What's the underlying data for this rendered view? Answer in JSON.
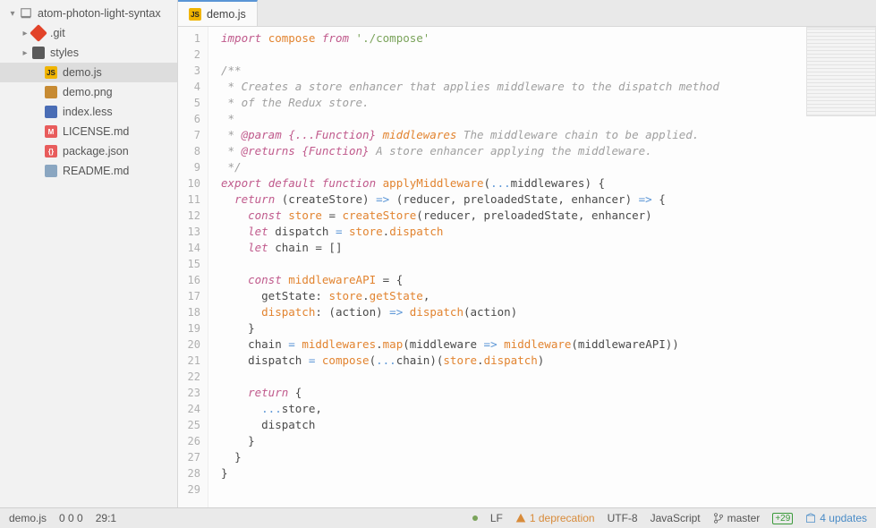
{
  "sidebar": {
    "root": "atom-photon-light-syntax",
    "items": [
      {
        "label": ".git",
        "icon": "git",
        "indent": 1,
        "chev": true
      },
      {
        "label": "styles",
        "icon": "folder",
        "indent": 1,
        "chev": true
      },
      {
        "label": "demo.js",
        "icon": "js",
        "indent": 2,
        "active": true
      },
      {
        "label": "demo.png",
        "icon": "png",
        "indent": 2
      },
      {
        "label": "index.less",
        "icon": "less",
        "indent": 2
      },
      {
        "label": "LICENSE.md",
        "icon": "md",
        "indent": 2
      },
      {
        "label": "package.json",
        "icon": "json",
        "indent": 2
      },
      {
        "label": "README.md",
        "icon": "readme",
        "indent": 2
      }
    ]
  },
  "tab": {
    "label": "demo.js"
  },
  "code_lines": 29,
  "status": {
    "file": "demo.js",
    "counts": "0   0   0",
    "cursor": "29:1",
    "eol": "LF",
    "deprecations": "1 deprecation",
    "encoding": "UTF-8",
    "language": "JavaScript",
    "branch": "master",
    "git_add": "+29",
    "updates": "4 updates"
  },
  "code": {
    "l1_import": "import",
    "l1_compose": "compose",
    "l1_from": "from",
    "l1_str": "'./compose'",
    "l3": "/**",
    "l4": " * Creates a store enhancer that applies middleware to the dispatch method",
    "l5": " * of the Redux store.",
    "l6": " *",
    "l7_a": " * ",
    "l7_tag": "@param",
    "l7_type": " {...Function}",
    "l7_name": " middlewares",
    "l7_rest": " The middleware chain to be applied.",
    "l8_a": " * ",
    "l8_tag": "@returns",
    "l8_type": " {Function}",
    "l8_rest": " A store enhancer applying the middleware.",
    "l9": " */",
    "l10_export": "export",
    "l10_default": "default",
    "l10_function": "function",
    "l10_name": "applyMiddleware",
    "l10_spread": "...",
    "l10_rest": "middlewares) {",
    "l11_return": "return",
    "l11_a": " (createStore) ",
    "l11_arrow": "=>",
    "l11_b": " (reducer, preloadedState, enhancer) ",
    "l11_arrow2": "=>",
    "l11_c": " {",
    "l12_const": "const",
    "l12_store": "store",
    "l12_eq": " = ",
    "l12_fn": "createStore",
    "l12_args": "(reducer, preloadedState, enhancer)",
    "l13_let": "let",
    "l13_a": " dispatch ",
    "l13_eq": "=",
    "l13_b": " ",
    "l13_store": "store",
    "l13_dot": ".",
    "l13_disp": "dispatch",
    "l14_let": "let",
    "l14_rest": " chain = []",
    "l16_const": "const",
    "l16_name": "middlewareAPI",
    "l16_rest": " = {",
    "l17_a": "getState",
    "l17_col": ": ",
    "l17_store": "store",
    "l17_dot": ".",
    "l17_gs": "getState",
    "l17_comma": ",",
    "l18_disp": "dispatch",
    "l18_col": ":",
    "l18_a": " (action) ",
    "l18_arrow": "=>",
    "l18_b": " ",
    "l18_fn": "dispatch",
    "l18_args": "(action)",
    "l19": "}",
    "l20_a": "chain ",
    "l20_eq": "=",
    "l20_b": " ",
    "l20_mw": "middlewares",
    "l20_dot": ".",
    "l20_map": "map",
    "l20_c": "(middleware ",
    "l20_arrow": "=>",
    "l20_d": " ",
    "l20_fn": "middleware",
    "l20_args": "(middlewareAPI))",
    "l21_a": "dispatch ",
    "l21_eq": "=",
    "l21_b": " ",
    "l21_comp": "compose",
    "l21_c": "(",
    "l21_spread": "...",
    "l21_d": "chain)(",
    "l21_store": "store",
    "l21_dot": ".",
    "l21_disp": "dispatch",
    "l21_e": ")",
    "l23_return": "return",
    "l23_rest": " {",
    "l24_spread": "...",
    "l24_rest": "store,",
    "l25": "dispatch",
    "l26": "}",
    "l27": "}",
    "l28": "}"
  }
}
